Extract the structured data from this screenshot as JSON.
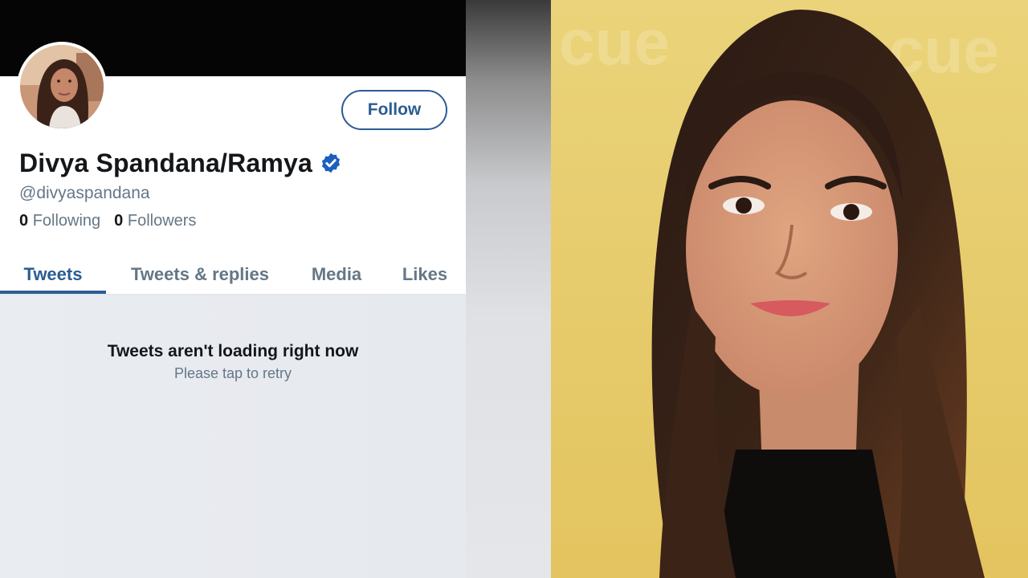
{
  "profile": {
    "follow_label": "Follow",
    "display_name": "Divya Spandana/Ramya",
    "verified": true,
    "handle": "@divyaspandana",
    "following_count": "0",
    "following_label": "Following",
    "followers_count": "0",
    "followers_label": "Followers"
  },
  "tabs": [
    {
      "label": "Tweets",
      "active": true
    },
    {
      "label": "Tweets & replies",
      "active": false
    },
    {
      "label": "Media",
      "active": false
    },
    {
      "label": "Likes",
      "active": false
    }
  ],
  "empty_state": {
    "title": "Tweets aren't loading right now",
    "subtitle": "Please tap to retry"
  },
  "photo": {
    "backdrop_text": "cue"
  },
  "colors": {
    "accent": "#2b5c93",
    "verified_badge": "#1d5fbf",
    "header": "#050505",
    "backdrop": "#e7cd6a"
  }
}
